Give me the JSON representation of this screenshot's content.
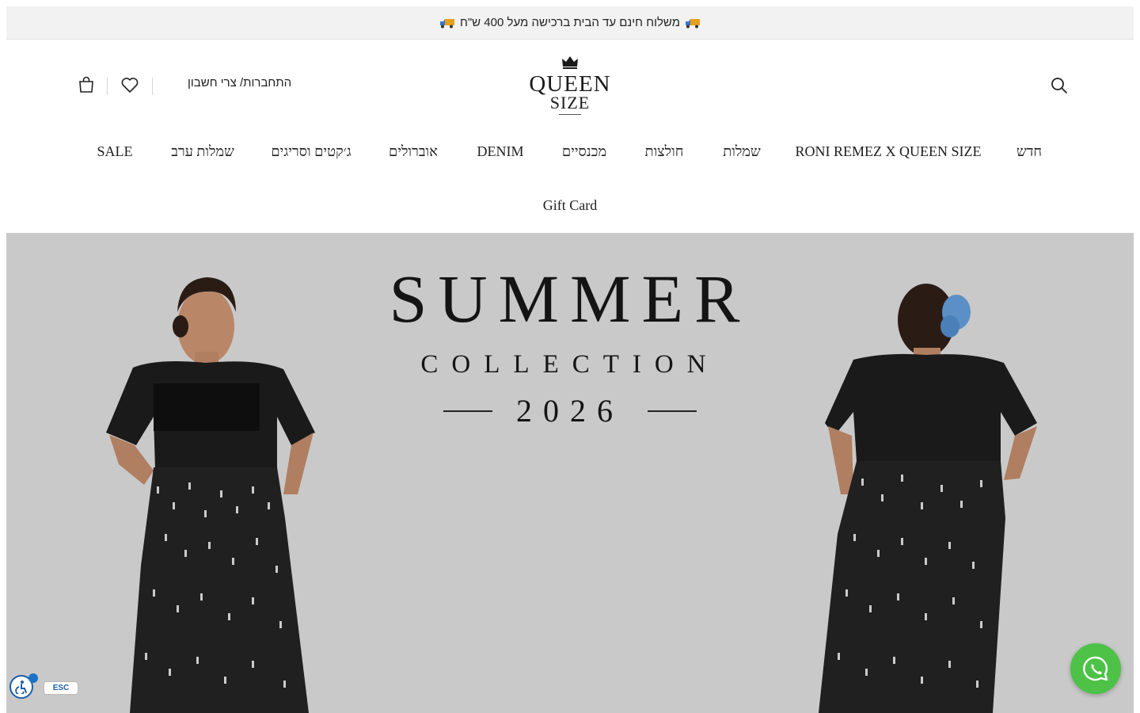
{
  "announcement": {
    "text": "משלוח חינם עד הבית ברכישה מעל 400 ש\"ח",
    "icon": "truck-icon"
  },
  "header": {
    "logo_line1": "QUEEN",
    "logo_line2": "SIZE",
    "logo_icon": "crown-icon",
    "login_label": "התחברות/ צרי חשבון",
    "search_icon": "search-icon",
    "wishlist_icon": "heart-icon",
    "cart_icon": "shopping-bag-icon"
  },
  "nav": {
    "items": [
      "חדש",
      "RONI REMEZ X QUEEN SIZE",
      "שמלות",
      "חולצות",
      "מכנסיים",
      "DENIM",
      "אוברולים",
      "ג׳קטים וסריגים",
      "שמלות ערב",
      "SALE",
      "Gift Card"
    ]
  },
  "hero": {
    "title": "SUMMER",
    "subtitle": "COLLECTION",
    "year": "2026",
    "background": "#c9c9c9"
  },
  "widgets": {
    "whatsapp_icon": "whatsapp-icon",
    "whatsapp_color": "#4dc247",
    "accessibility_icon": "accessibility-icon",
    "esc_label": "ESC"
  }
}
